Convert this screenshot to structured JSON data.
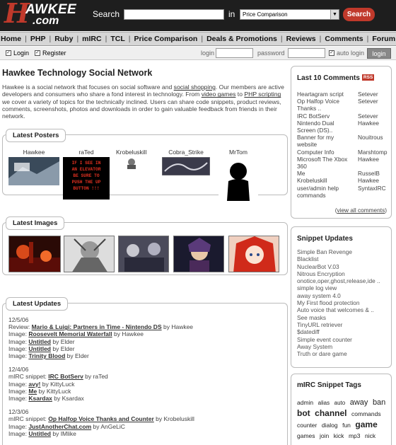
{
  "header": {
    "logo_h": "H",
    "logo_awkee": "AWKEE",
    "logo_com": ".com",
    "search_label": "Search",
    "search_value": "",
    "in_label": "in",
    "search_scope": "Price Comparison",
    "search_button": "Search"
  },
  "nav": {
    "items": [
      "Home",
      "PHP",
      "Ruby",
      "mIRC",
      "TCL",
      "Price Comparison",
      "Deals & Promotions",
      "Reviews",
      "Comments",
      "Forum"
    ]
  },
  "loginbar": {
    "login_link": "Login",
    "register_link": "Register",
    "login_label": "login",
    "password_label": "password",
    "auto_login_label": "auto login",
    "login_button": "login"
  },
  "main": {
    "title": "Hawkee Technology Social Network",
    "intro": {
      "p1": "Hawkee is a social network that focuses on social software and ",
      "l1": "social shopping",
      "p2": ". Our members are active developers and consumers who share a fond interest in technology. From ",
      "l2": "video games",
      "p3": " to ",
      "l3": "PHP scripting",
      "p4": " we cover a variety of topics for the technically inclined. Users can share code snippets, product reviews, comments, screenshots, photos and downloads in order to gain valuable feedback from friends in their network."
    },
    "latest_posters_title": "Latest Posters",
    "posters": [
      {
        "name": "Hawkee"
      },
      {
        "name": "raTed"
      },
      {
        "name": "Krobeluskill"
      },
      {
        "name": "Cobra_Strike"
      },
      {
        "name": "MrTom"
      }
    ],
    "latest_images_title": "Latest Images",
    "latest_updates_title": "Latest Updates",
    "updates": [
      {
        "date": "12/5/06",
        "items": [
          {
            "prefix": "Review: ",
            "link": "Mario & Luigi: Partners in Time - Nintendo DS",
            "by": " by Hawkee"
          },
          {
            "prefix": "Image: ",
            "link": "Roosevelt Memorial Waterfall",
            "by": " by Hawkee"
          },
          {
            "prefix": "Image: ",
            "link": "Untitled",
            "by": " by Elder"
          },
          {
            "prefix": "Image: ",
            "link": "Untitled",
            "by": " by Elder"
          },
          {
            "prefix": "Image: ",
            "link": "Trinity Blood",
            "by": " by Elder"
          }
        ]
      },
      {
        "date": "12/4/06",
        "items": [
          {
            "prefix": "mIRC snippet: ",
            "link": "IRC BotServ",
            "by": " by raTed"
          },
          {
            "prefix": "Image: ",
            "link": "avy!",
            "by": " by KittyLuck"
          },
          {
            "prefix": "Image: ",
            "link": "Me",
            "by": " by KittyLuck"
          },
          {
            "prefix": "Image: ",
            "link": "Ksardax",
            "by": " by Ksardax"
          }
        ]
      },
      {
        "date": "12/3/06",
        "items": [
          {
            "prefix": "mIRC snippet: ",
            "link": "Op Halfop Voice Thanks and Counter",
            "by": " by Krobeluskill"
          },
          {
            "prefix": "Image: ",
            "link": "JustAnotherChat.com",
            "by": " by AnGeLiC"
          },
          {
            "prefix": "Image: ",
            "link": "Untitled",
            "by": " by IMlike"
          }
        ]
      }
    ]
  },
  "sidebar": {
    "comments_title": "Last 10 Comments",
    "rss": "RSS",
    "comments": [
      {
        "t": "Heartagram script",
        "u": "Setever"
      },
      {
        "t": "Op Halfop Voice Thanks ..",
        "u": "Setever"
      },
      {
        "t": "IRC BotServ",
        "u": "Setever"
      },
      {
        "t": "Nintendo Dual Screen (DS)..",
        "u": "Hawkee"
      },
      {
        "t": "Banner for my website",
        "u": "Nouitrous"
      },
      {
        "t": "Computer Info",
        "u": "Marshtomp"
      },
      {
        "t": "Microsoft The Xbox 360",
        "u": "Hawkee"
      },
      {
        "t": "Me",
        "u": "RusselB"
      },
      {
        "t": "Krobeluskill",
        "u": "Hawkee"
      },
      {
        "t": "user/admin help commands",
        "u": "SyntaxIRC"
      }
    ],
    "view_all": "view all comments",
    "snippets_title": "Snippet Updates",
    "snippets": [
      "Simple Ban Revenge",
      "Blacklist",
      "NuclearBot V.03",
      "Nitrous Encryption",
      "onotice,oper,ghost,release,ide ..",
      "simple log view",
      "away system 4.0",
      "My First flood protection",
      "Auto voice that welcomes & ..",
      "See masks",
      "TinyURL retriever",
      "$datediff",
      "Simple event counter",
      "Away System",
      "Truth or dare game"
    ],
    "tags_title": "mIRC Snippet Tags",
    "tags": [
      {
        "w": "admin",
        "s": 1
      },
      {
        "w": "alias",
        "s": 0
      },
      {
        "w": "auto",
        "s": 0
      },
      {
        "w": "away",
        "s": 2
      },
      {
        "w": "ban",
        "s": 2
      },
      {
        "w": "bot",
        "s": 3
      },
      {
        "w": "channel",
        "s": 3
      },
      {
        "w": "commands",
        "s": 1
      },
      {
        "w": "counter",
        "s": 1
      },
      {
        "w": "dialog",
        "s": 1
      },
      {
        "w": "fun",
        "s": 1
      },
      {
        "w": "game",
        "s": 3
      },
      {
        "w": "games",
        "s": 1
      },
      {
        "w": "join",
        "s": 1
      },
      {
        "w": "kick",
        "s": 1
      },
      {
        "w": "mp3",
        "s": 1
      },
      {
        "w": "nick",
        "s": 1
      }
    ]
  },
  "colors": {
    "accent": "#c0392b",
    "header_bg": "#1e1e1e",
    "nav_bg": "#d6d6d6"
  }
}
